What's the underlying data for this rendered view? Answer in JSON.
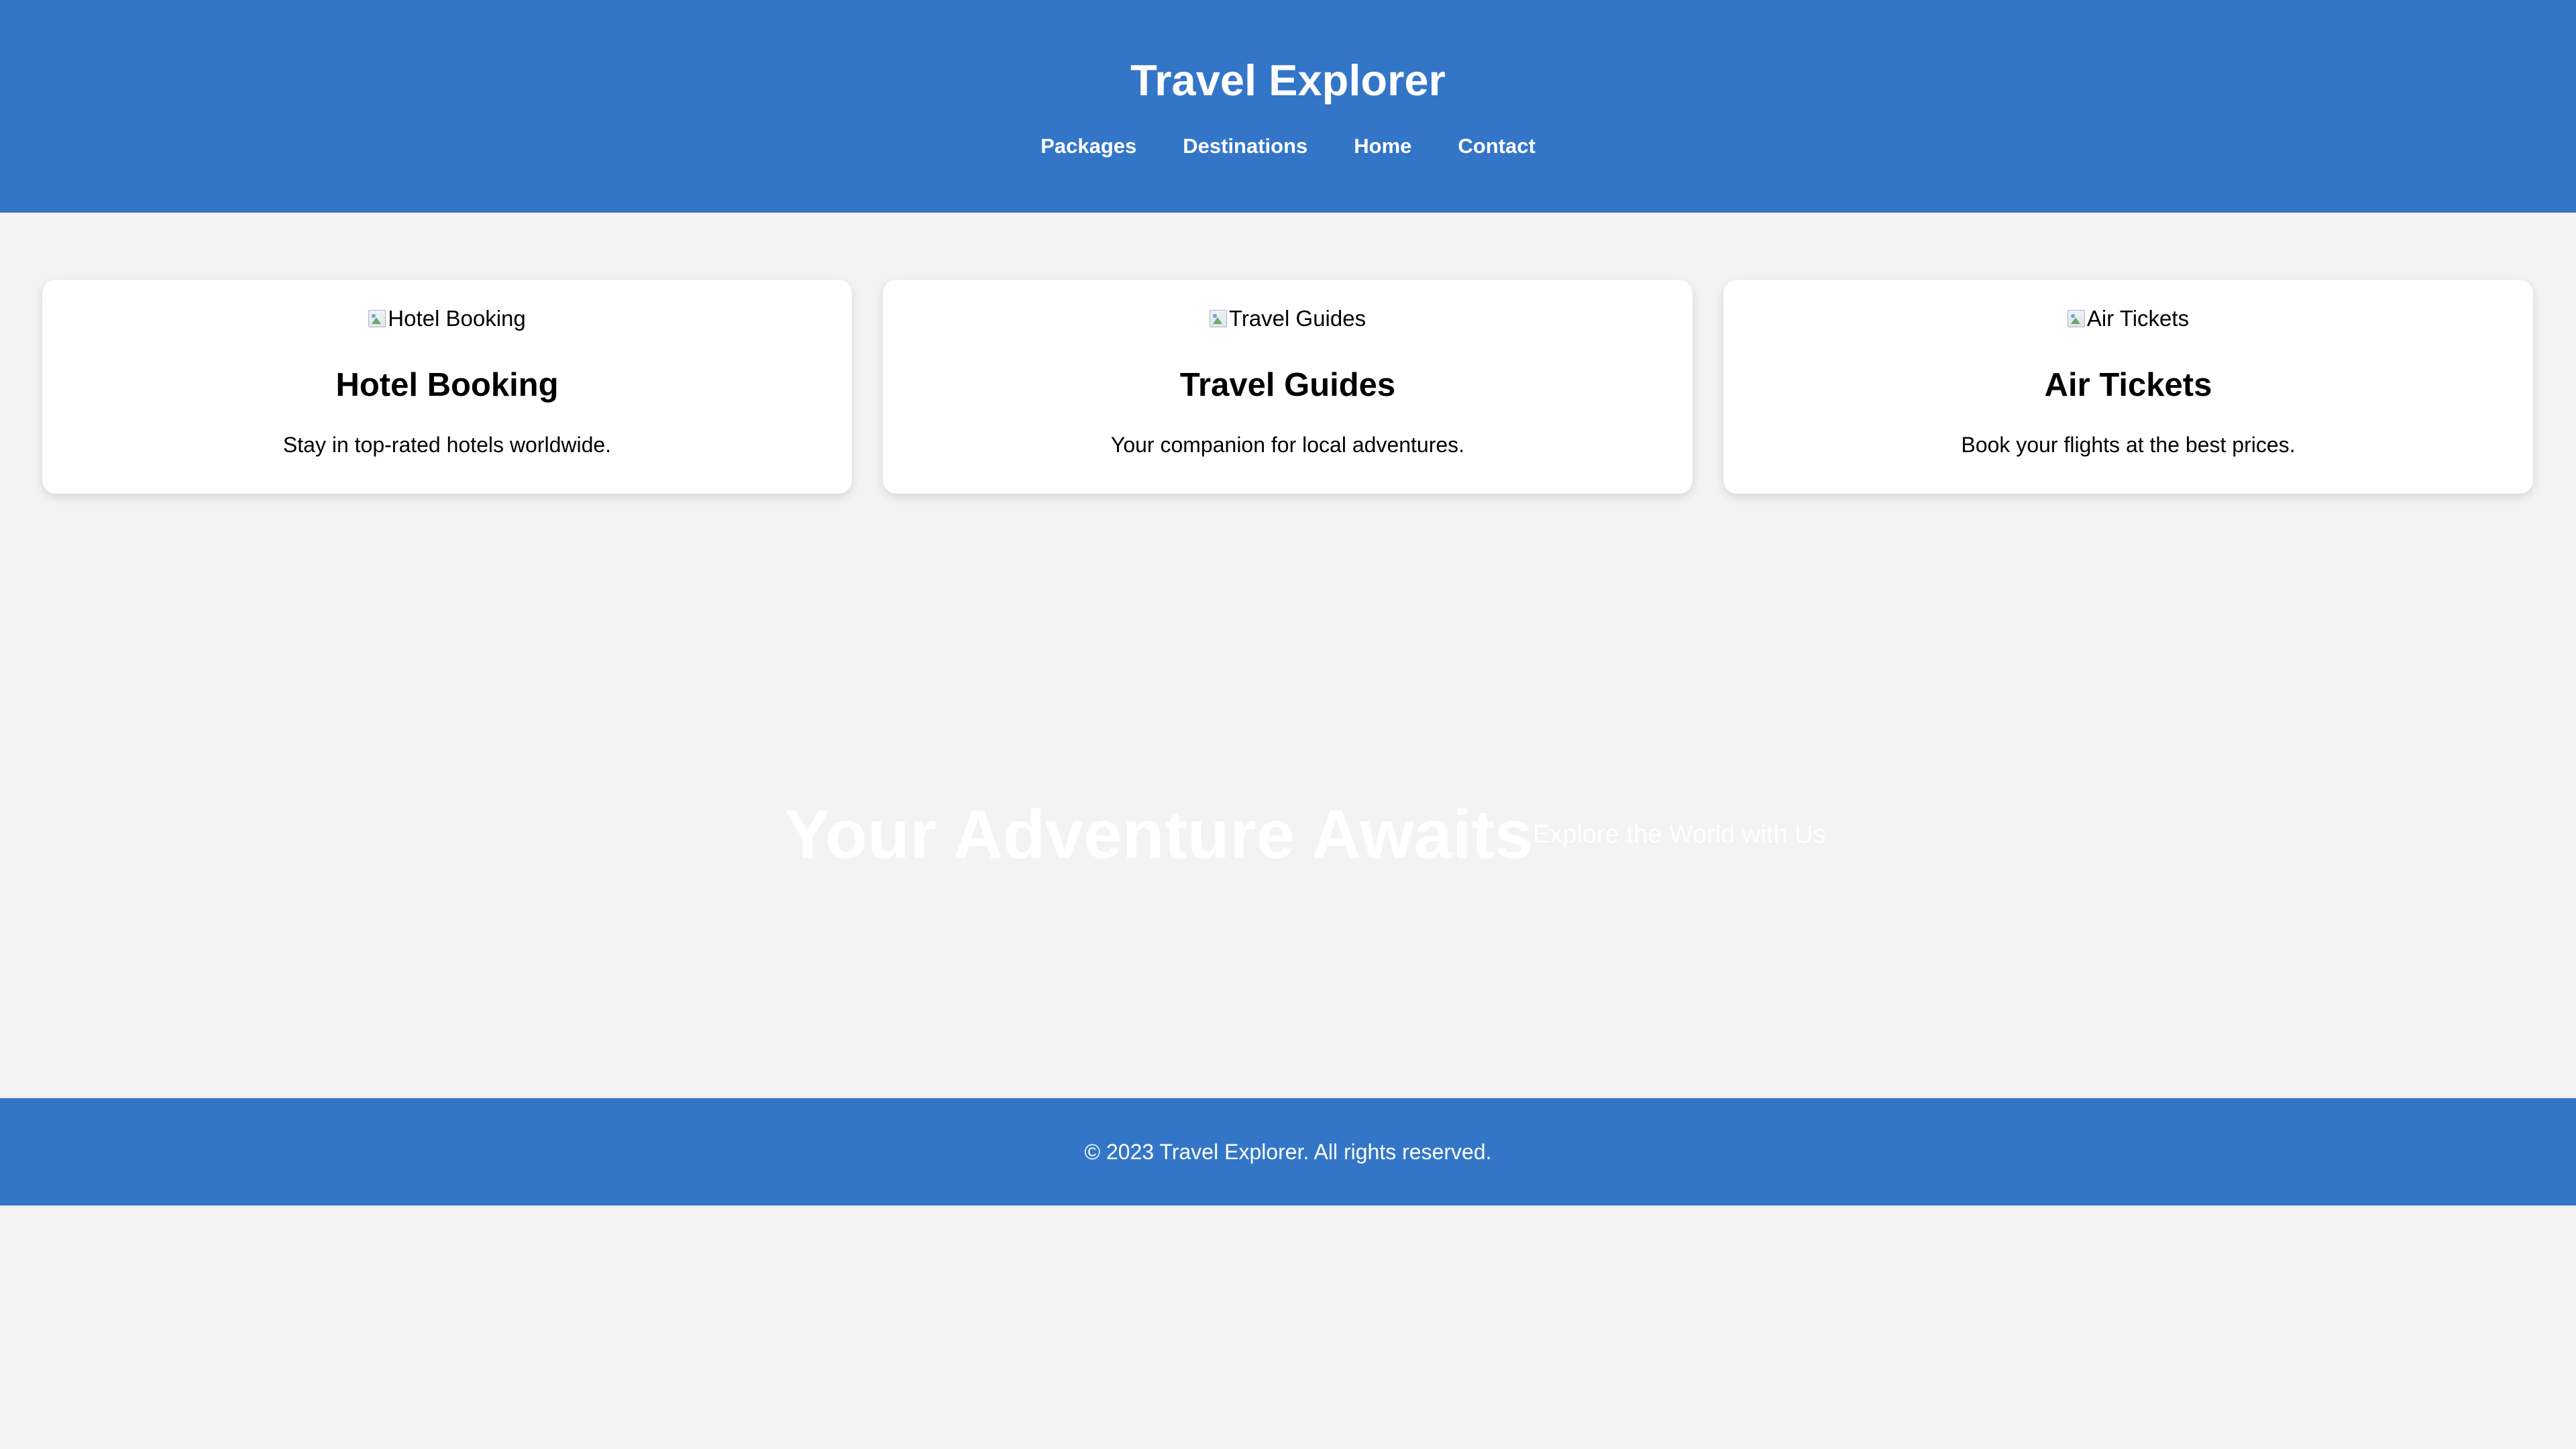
{
  "header": {
    "title": "Travel Explorer",
    "nav": [
      {
        "label": "Packages"
      },
      {
        "label": "Destinations"
      },
      {
        "label": "Home"
      },
      {
        "label": "Contact"
      }
    ]
  },
  "services": [
    {
      "image_alt": "Hotel Booking",
      "title": "Hotel Booking",
      "description": "Stay in top-rated hotels worldwide."
    },
    {
      "image_alt": "Travel Guides",
      "title": "Travel Guides",
      "description": "Your companion for local adventures."
    },
    {
      "image_alt": "Air Tickets",
      "title": "Air Tickets",
      "description": "Book your flights at the best prices."
    }
  ],
  "hero": {
    "title": "Your Adventure Awaits",
    "subtitle": "Explore the World with Us"
  },
  "footer": {
    "text": "© 2023 Travel Explorer. All rights reserved."
  },
  "icons": {
    "image_placeholder": "broken-image-icon"
  },
  "colors": {
    "brand_blue": "#3376c8",
    "page_background": "#f3f3f3",
    "card_background": "#ffffff",
    "text": "#000000",
    "inverse_text": "#ffffff"
  }
}
